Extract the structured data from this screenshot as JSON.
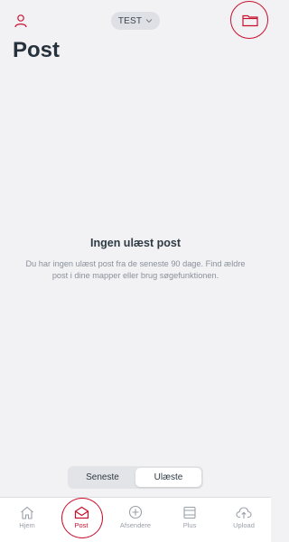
{
  "header": {
    "profile_icon": "person-icon",
    "environment_label": "TEST",
    "environment_icon": "chevron-down-icon",
    "folder_icon": "folder-icon"
  },
  "page": {
    "title": "Post"
  },
  "empty_state": {
    "title": "Ingen ulæst post",
    "message": "Du har ingen ulæst post fra de seneste 90 dage. Find ældre post i dine mapper eller brug søgefunktionen."
  },
  "segmented_control": {
    "options": [
      {
        "label": "Seneste",
        "selected": false
      },
      {
        "label": "Ulæste",
        "selected": true
      }
    ]
  },
  "tabbar": {
    "items": [
      {
        "label": "Hjem",
        "icon": "home-icon",
        "active": false
      },
      {
        "label": "Post",
        "icon": "mail-icon",
        "active": true
      },
      {
        "label": "Afsendere",
        "icon": "add-circle-icon",
        "active": false
      },
      {
        "label": "Plus",
        "icon": "tray-icon",
        "active": false
      },
      {
        "label": "Upload",
        "icon": "cloud-upload-icon",
        "active": false
      }
    ]
  },
  "colors": {
    "accent": "#c8102e",
    "background": "#f2f2f5",
    "title_text": "#26323c",
    "muted_text": "#8a9099"
  }
}
